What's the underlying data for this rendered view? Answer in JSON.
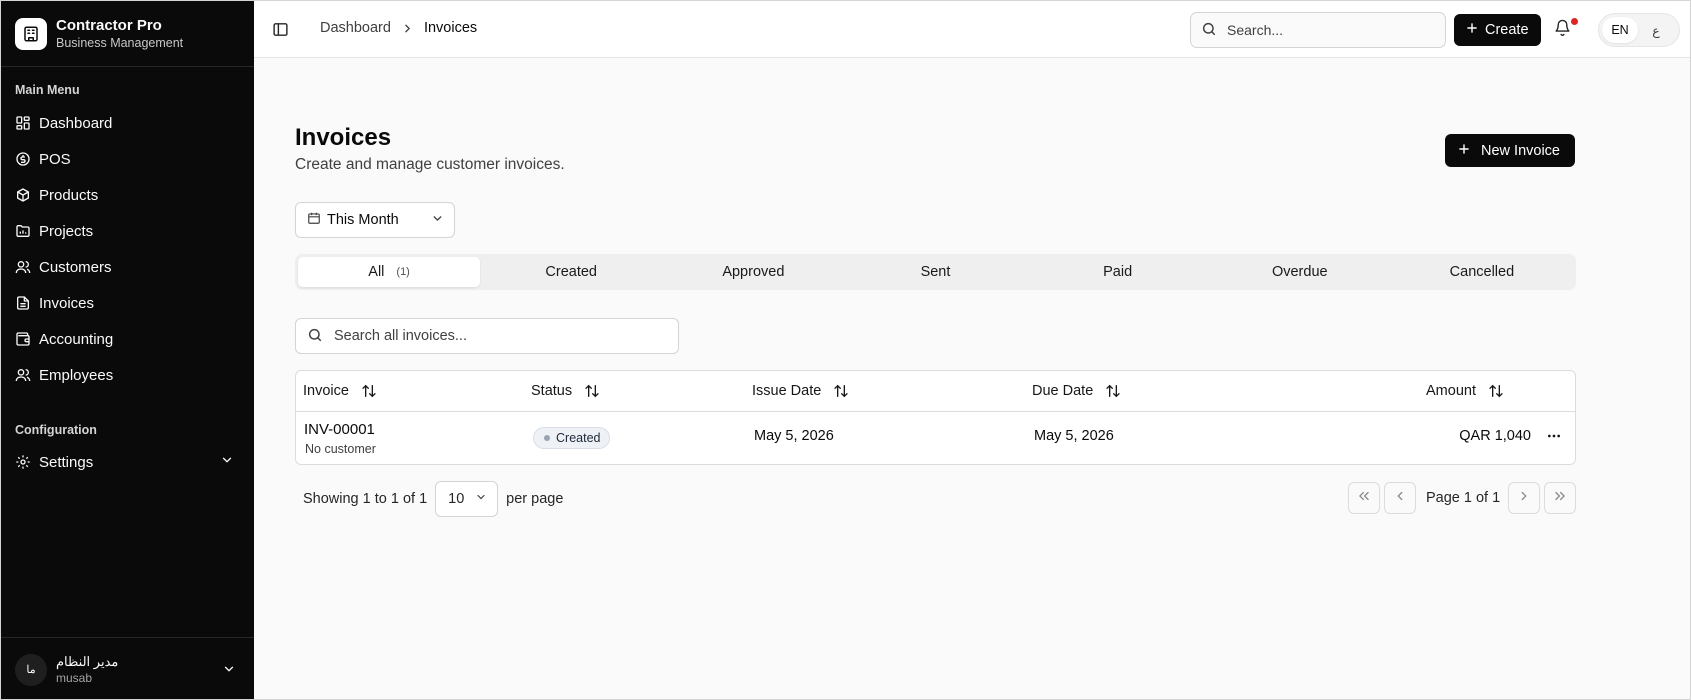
{
  "app": {
    "name": "Contractor Pro",
    "subtitle": "Business Management"
  },
  "sidebar": {
    "main_label": "Main Menu",
    "items": [
      {
        "label": "Dashboard",
        "icon": "dashboard-icon"
      },
      {
        "label": "POS",
        "icon": "pos-icon"
      },
      {
        "label": "Products",
        "icon": "box-icon"
      },
      {
        "label": "Projects",
        "icon": "projects-icon"
      },
      {
        "label": "Customers",
        "icon": "users-icon"
      },
      {
        "label": "Invoices",
        "icon": "file-icon"
      },
      {
        "label": "Accounting",
        "icon": "wallet-icon"
      },
      {
        "label": "Employees",
        "icon": "users-icon"
      }
    ],
    "config_label": "Configuration",
    "settings_label": "Settings",
    "user": {
      "initials": "ما",
      "name": "مدير النظام",
      "handle": "musab"
    }
  },
  "header": {
    "breadcrumb": [
      "Dashboard",
      "Invoices"
    ],
    "search_placeholder": "Search...",
    "create_label": "Create",
    "lang_en": "EN",
    "lang_ar": "ع"
  },
  "page": {
    "title": "Invoices",
    "subtitle": "Create and manage customer invoices.",
    "new_button": "New Invoice",
    "period": "This Month",
    "tabs": [
      {
        "label": "All",
        "count": "(1)"
      },
      {
        "label": "Created"
      },
      {
        "label": "Approved"
      },
      {
        "label": "Sent"
      },
      {
        "label": "Paid"
      },
      {
        "label": "Overdue"
      },
      {
        "label": "Cancelled"
      }
    ],
    "table_search_placeholder": "Search all invoices..."
  },
  "table": {
    "columns": [
      "Invoice",
      "Status",
      "Issue Date",
      "Due Date",
      "Amount"
    ],
    "rows": [
      {
        "invoice": "INV-00001",
        "customer": "No customer",
        "status": "Created",
        "issue_date": "May 5, 2026",
        "due_date": "May 5, 2026",
        "amount": "QAR 1,040"
      }
    ]
  },
  "pagination": {
    "showing": "Showing 1 to 1 of 1",
    "per_page_value": "10",
    "per_page_label": "per page",
    "page_label": "Page 1 of 1"
  },
  "colors": {
    "sidebar_bg": "#0a0a0a",
    "primary": "#0a0a0a",
    "notification": "#dc2626"
  }
}
